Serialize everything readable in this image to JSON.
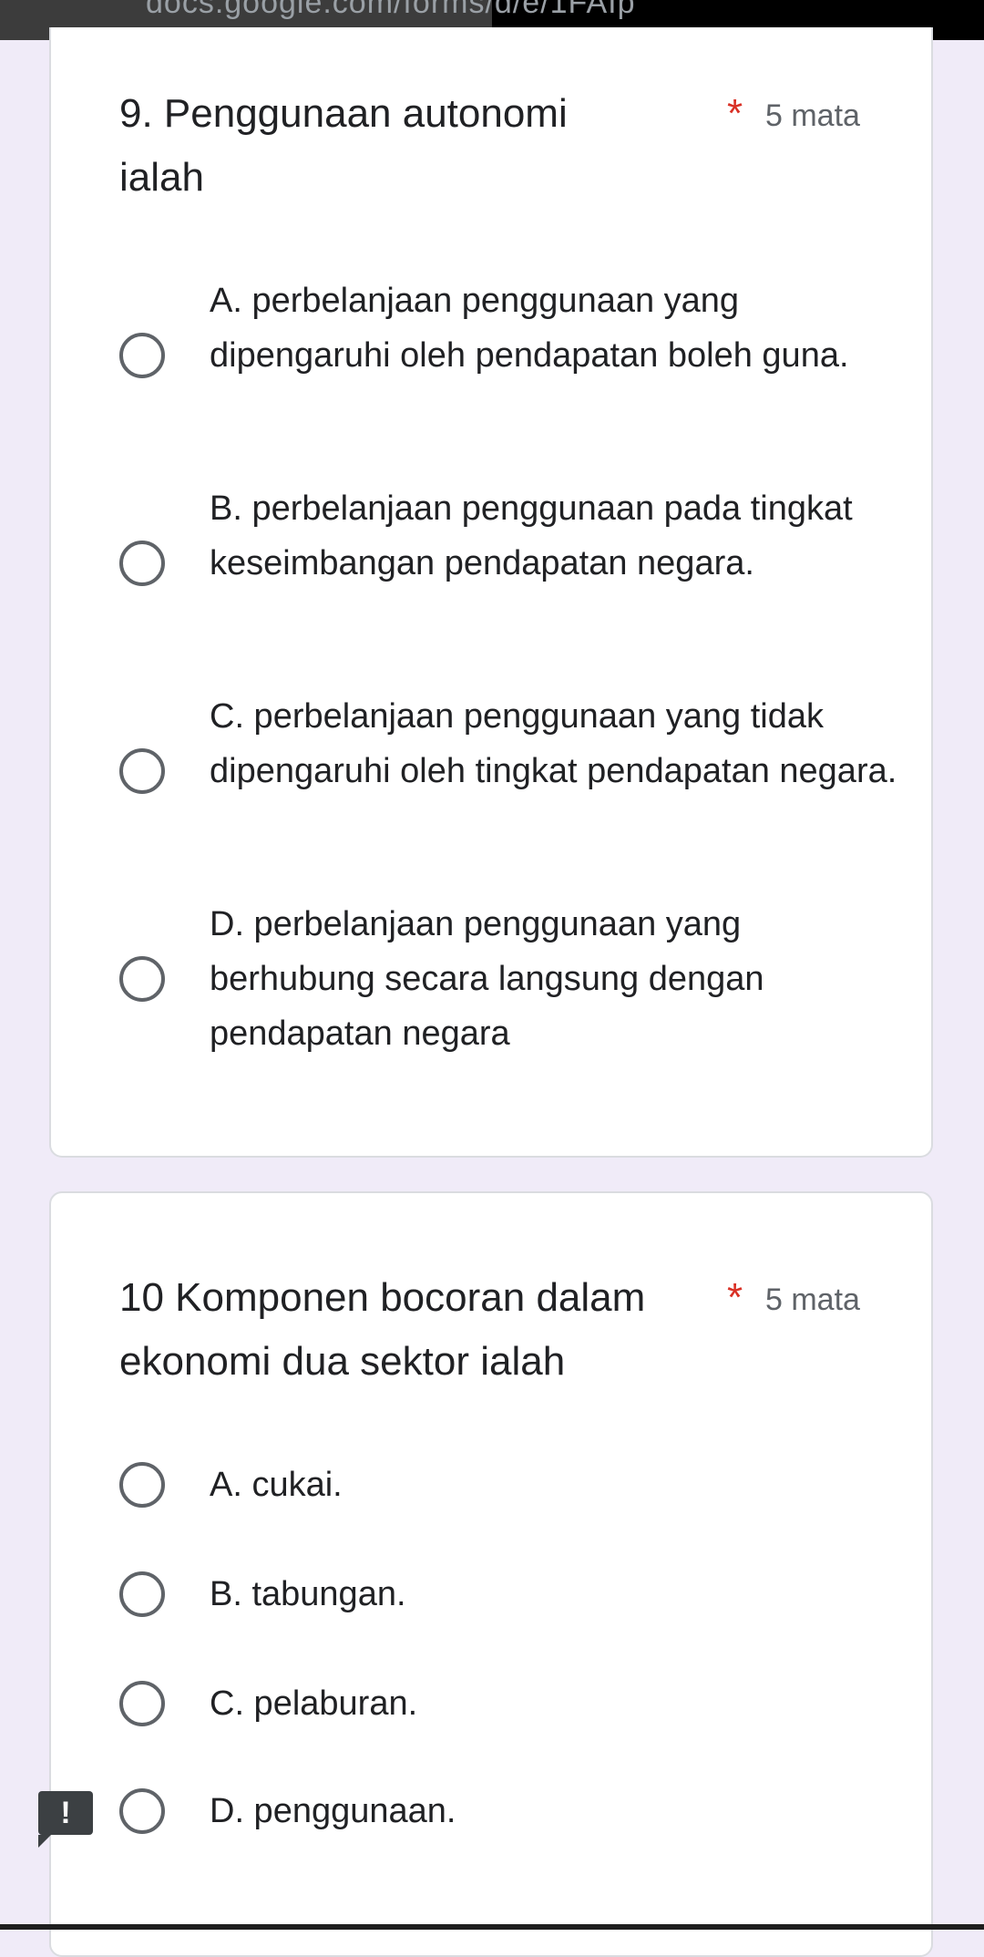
{
  "browser": {
    "url": "docs.google.com/forms/d/e/1FAIp"
  },
  "q9": {
    "title_line1": "9.  Penggunaan autonomi",
    "title_line2": "ialah",
    "required_marker": "*",
    "points": "5 mata",
    "options": [
      {
        "label": "A. perbelanjaan penggunaan yang dipengaruhi oleh pendapatan boleh guna."
      },
      {
        "label": "B. perbelanjaan penggunaan pada tingkat keseimbangan pendapatan negara."
      },
      {
        "label": "C. perbelanjaan penggunaan yang tidak dipengaruhi oleh tingkat pendapatan negara."
      },
      {
        "label": "D. perbelanjaan penggunaan yang berhubung secara langsung dengan pendapatan negara"
      }
    ]
  },
  "q10": {
    "title_line1": "10  Komponen bocoran dalam",
    "title_line2": "ekonomi dua sektor ialah",
    "required_marker": "*",
    "points": "5 mata",
    "options": [
      {
        "label": "A. cukai."
      },
      {
        "label": "B. tabungan."
      },
      {
        "label": "C. pelaburan."
      },
      {
        "label": "D. penggunaan."
      }
    ]
  },
  "alert_badge": "!",
  "colors": {
    "page_bg": "#f0ebf8",
    "card_bg": "#ffffff",
    "required": "#d93025",
    "radio_border": "#5f6368"
  }
}
